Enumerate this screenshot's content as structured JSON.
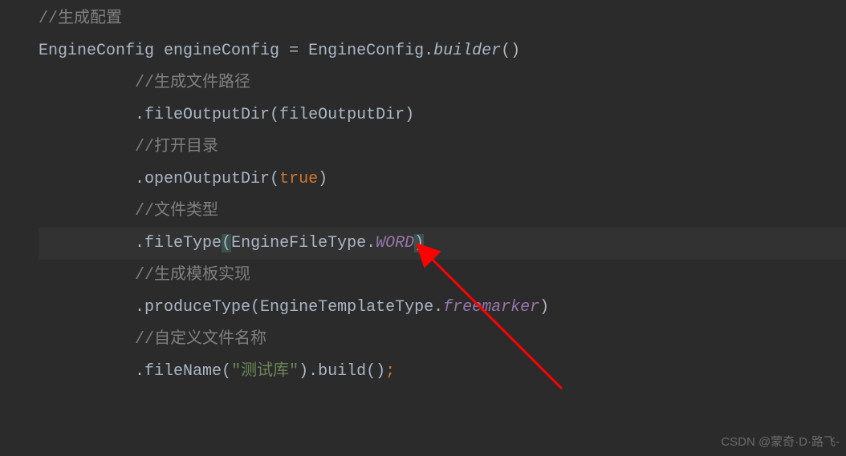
{
  "code": {
    "line1_comment": "//生成配置",
    "line2_p1": "EngineConfig engineConfig ",
    "line2_p2": "= ",
    "line2_p3": "EngineConfig.",
    "line2_p4": "builder",
    "line2_p5": "()",
    "line3_comment": "//生成文件路径",
    "line4_p1": ".fileOutputDir(fileOutputDir)",
    "line5_comment": "//打开目录",
    "line6_p1": ".openOutputDir(",
    "line6_p2": "true",
    "line6_p3": ")",
    "line7_comment": "//文件类型",
    "line8_p1": ".fileType",
    "line8_paren_open": "(",
    "line8_p2": "EngineFileType.",
    "line8_p3": "WORD",
    "line8_paren_close": ")",
    "line9_comment": "//生成模板实现",
    "line10_p1": ".produceType(EngineTemplateType.",
    "line10_p2": "freemarker",
    "line10_p3": ")",
    "line11_comment": "//自定义文件名称",
    "line12_p1": ".fileName(",
    "line12_p2": "\"测试库\"",
    "line12_p3": ").build()",
    "line12_p4": ";"
  },
  "watermark": "CSDN @蒙奇·D·路飞-"
}
